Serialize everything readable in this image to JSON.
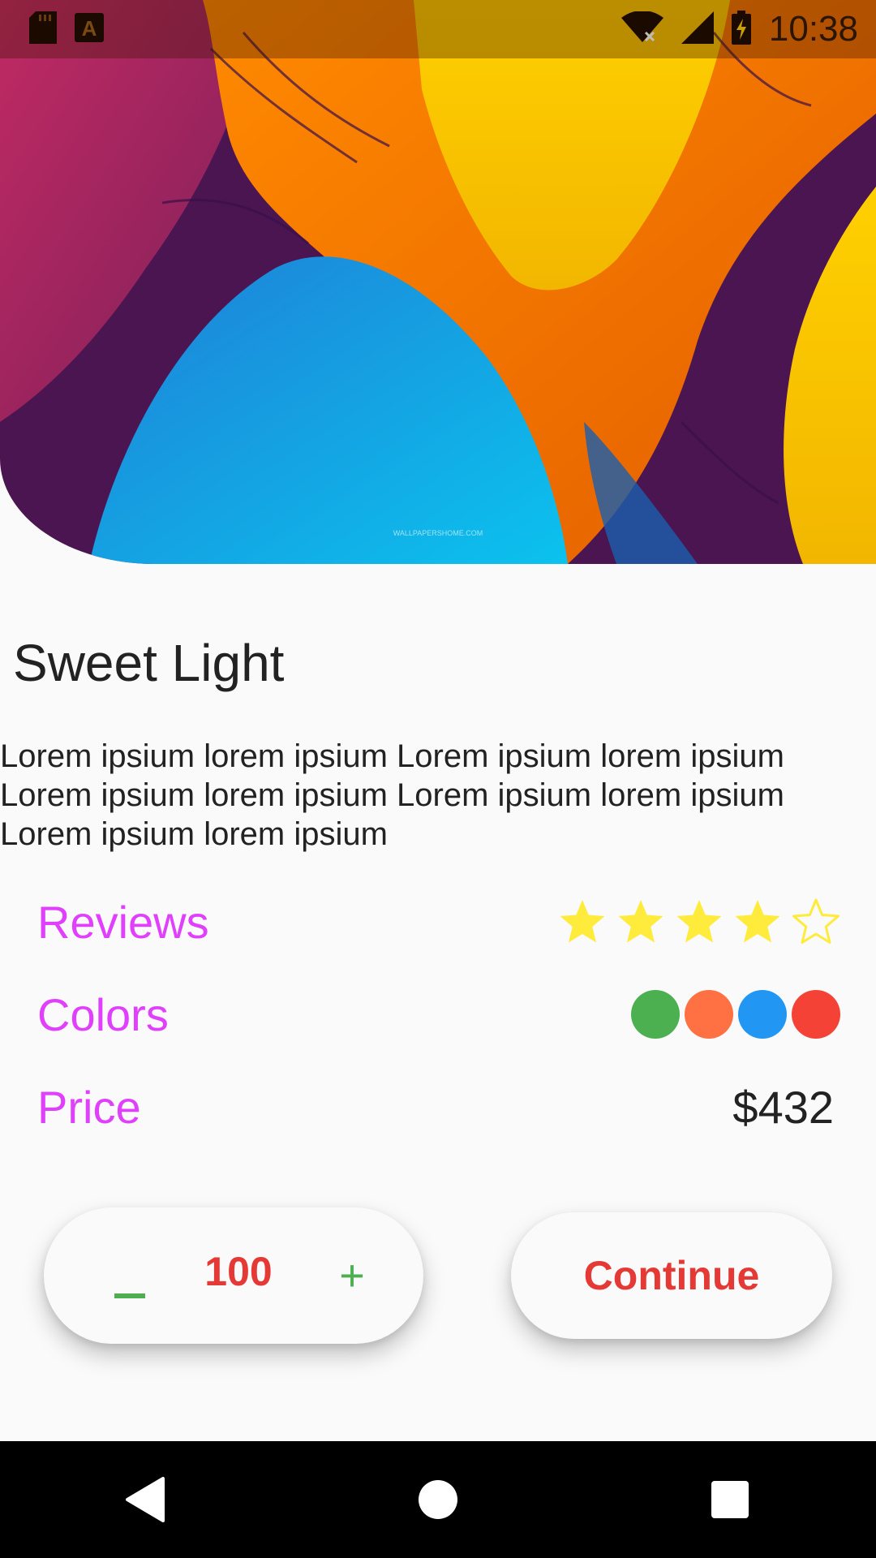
{
  "status_bar": {
    "time": "10:38",
    "icons": [
      "sd-card-icon",
      "a-notification-icon",
      "wifi-off-icon",
      "signal-icon",
      "battery-charging-icon"
    ]
  },
  "hero": {
    "watermark": "WALLPAPERSHOME.COM",
    "colors": [
      "#d23b6e",
      "#6a1f63",
      "#ff7a00",
      "#f7c600",
      "#0bb4e8",
      "#3b0f4a"
    ]
  },
  "product": {
    "title": "Sweet Light",
    "description": "Lorem ipsium lorem ipsium Lorem ipsium lorem ipsium Lorem ipsium lorem ipsium Lorem ipsium lorem ipsium Lorem ipsium lorem ipsium"
  },
  "details": {
    "reviews_label": "Reviews",
    "rating": 4,
    "rating_max": 5,
    "colors_label": "Colors",
    "swatches": [
      "#4caf50",
      "#ff7043",
      "#2196f3",
      "#f44336"
    ],
    "price_label": "Price",
    "price": "$432"
  },
  "actions": {
    "minus_label": "_",
    "quantity": "100",
    "plus_label": "+",
    "continue_label": "Continue"
  },
  "theme": {
    "accent_label": "#e040fb",
    "action_red": "#e53935",
    "action_green": "#4caf50",
    "star": "#ffeb3b"
  }
}
